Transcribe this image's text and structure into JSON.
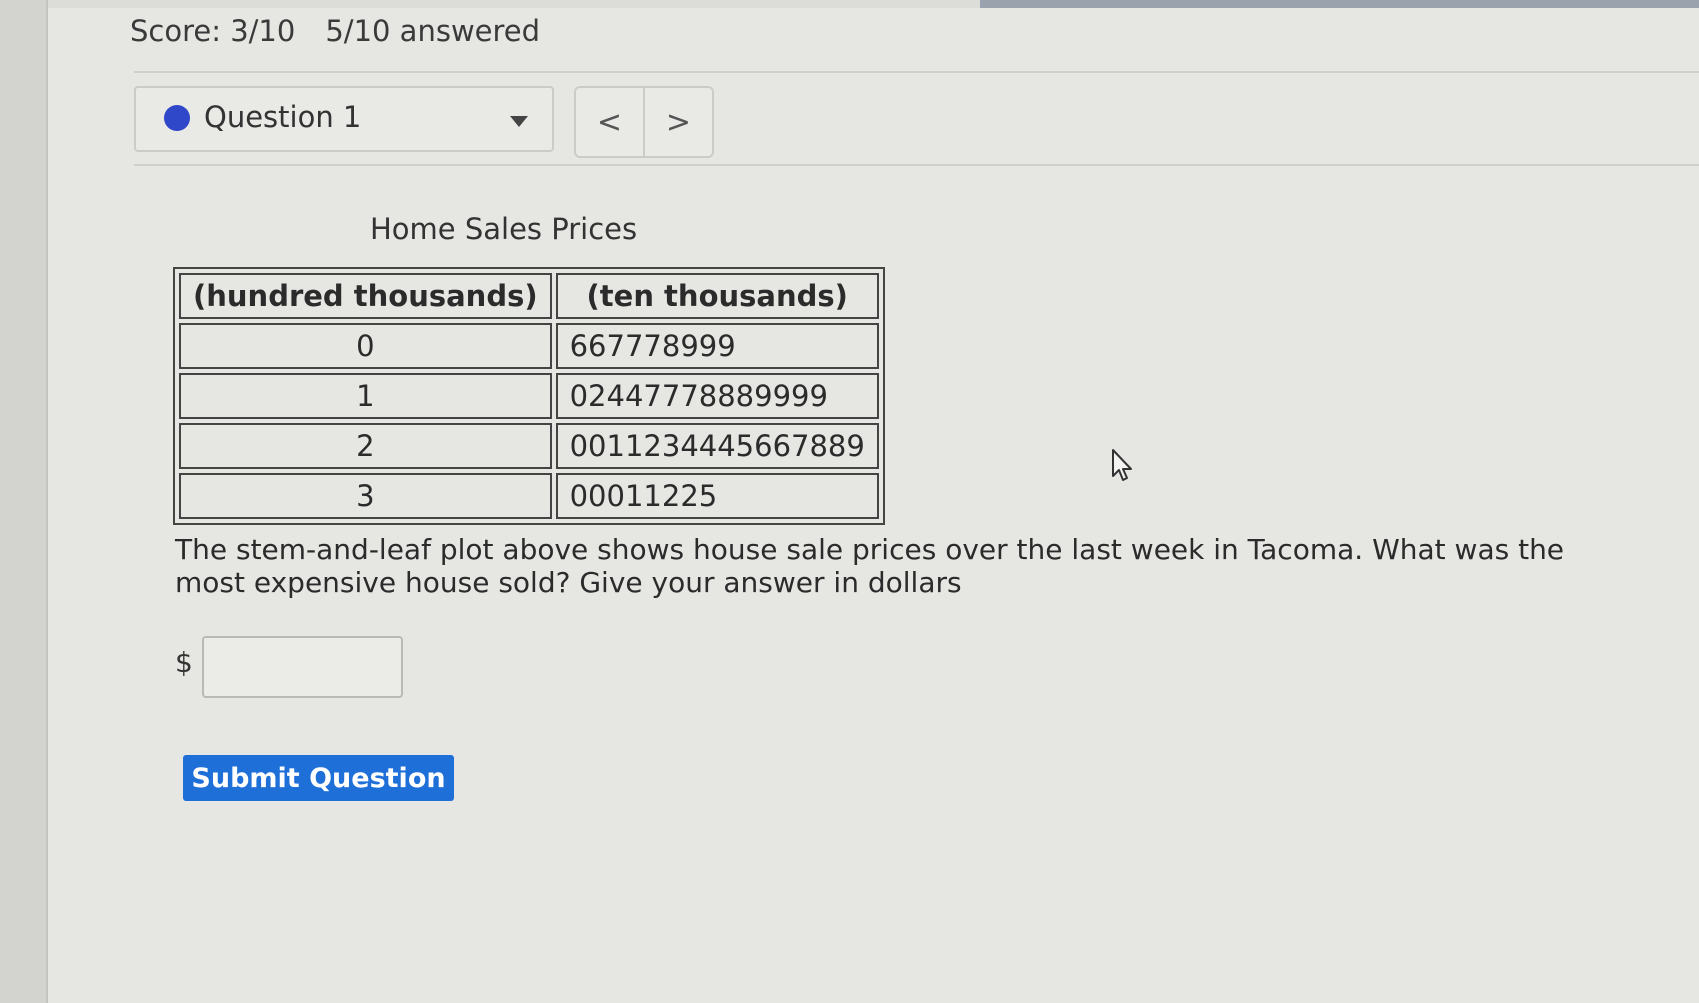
{
  "header": {
    "score": "Score: 3/10",
    "answered": "5/10 answered"
  },
  "question_nav": {
    "selected_question": "Question 1",
    "prev_symbol": "<",
    "next_symbol": ">",
    "status_color": "#2f47c9"
  },
  "table": {
    "title": "Home Sales Prices",
    "headers": [
      "(hundred thousands)",
      "(ten thousands)"
    ],
    "rows": [
      {
        "stem": "0",
        "leaf": "667778999"
      },
      {
        "stem": "1",
        "leaf": "02447778889999"
      },
      {
        "stem": "2",
        "leaf": "0011234445667889"
      },
      {
        "stem": "3",
        "leaf": "00011225"
      }
    ]
  },
  "question": {
    "prompt": "The stem-and-leaf plot above shows house sale prices over the last week in Tacoma. What was the most expensive house sold? Give your answer in dollars",
    "currency_symbol": "$",
    "answer_value": ""
  },
  "actions": {
    "submit_label": "Submit Question",
    "submit_color": "#1f6fd8"
  }
}
